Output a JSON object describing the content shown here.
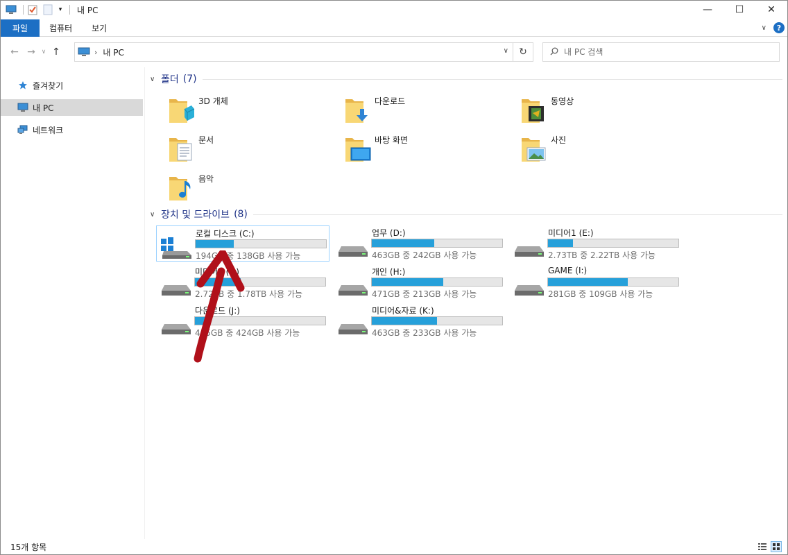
{
  "window": {
    "title": "내 PC"
  },
  "ribbon": {
    "tabs": [
      "파일",
      "컴퓨터",
      "보기"
    ]
  },
  "nav": {
    "breadcrumb": "내 PC",
    "search_placeholder": "내 PC 검색"
  },
  "sidebar": {
    "items": [
      {
        "label": "즐겨찾기",
        "icon": "star-icon"
      },
      {
        "label": "내 PC",
        "icon": "computer-icon",
        "selected": true
      },
      {
        "label": "네트워크",
        "icon": "network-icon"
      }
    ]
  },
  "folders": {
    "header": "폴더",
    "count": "(7)",
    "items": [
      {
        "name": "3D 개체",
        "icon": "3d-objects-folder-icon"
      },
      {
        "name": "다운로드",
        "icon": "downloads-folder-icon"
      },
      {
        "name": "동영상",
        "icon": "videos-folder-icon"
      },
      {
        "name": "문서",
        "icon": "documents-folder-icon"
      },
      {
        "name": "바탕 화면",
        "icon": "desktop-folder-icon"
      },
      {
        "name": "사진",
        "icon": "pictures-folder-icon"
      },
      {
        "name": "음악",
        "icon": "music-folder-icon"
      }
    ]
  },
  "drives": {
    "header": "장치 및 드라이브",
    "count": "(8)",
    "items": [
      {
        "name": "로컬 디스크 (C:)",
        "free_text": "194GB 중 138GB 사용 가능",
        "used_fraction": 0.29,
        "system": true
      },
      {
        "name": "업무 (D:)",
        "free_text": "463GB 중 242GB 사용 가능",
        "used_fraction": 0.48
      },
      {
        "name": "미디어1 (E:)",
        "free_text": "2.73TB 중 2.22TB 사용 가능",
        "used_fraction": 0.19
      },
      {
        "name": "미디어2 (F:)",
        "free_text": "2.72TB 중 1.78TB 사용 가능",
        "used_fraction": 0.35
      },
      {
        "name": "개인 (H:)",
        "free_text": "471GB 중 213GB 사용 가능",
        "used_fraction": 0.55
      },
      {
        "name": "GAME (I:)",
        "free_text": "281GB 중 109GB 사용 가능",
        "used_fraction": 0.61
      },
      {
        "name": "다운로드 (J:)",
        "free_text": "465GB 중 424GB 사용 가능",
        "used_fraction": 0.09
      },
      {
        "name": "미디어&자료 (K:)",
        "free_text": "463GB 중 233GB 사용 가능",
        "used_fraction": 0.5
      }
    ]
  },
  "status": {
    "item_count": "15개 항목"
  },
  "colors": {
    "accent": "#1c6fc4",
    "bar_fill": "#26a0da",
    "group_header": "#1e3287",
    "annotation_arrow": "#b0101a"
  }
}
